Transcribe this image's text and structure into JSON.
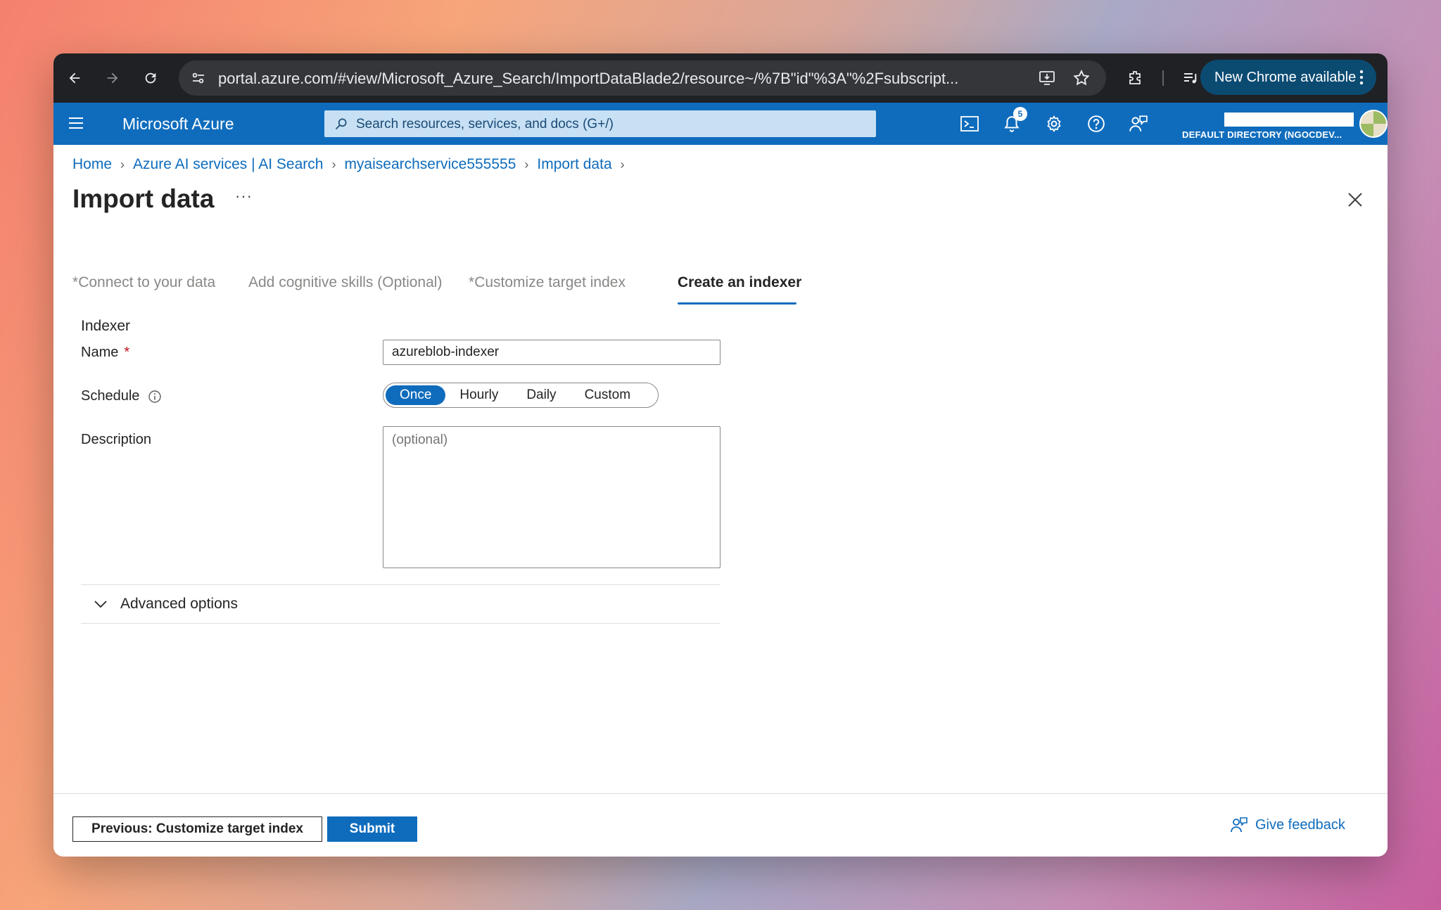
{
  "browser": {
    "url": "portal.azure.com/#view/Microsoft_Azure_Search/ImportDataBlade2/resource~/%7B\"id\"%3A\"%2Fsubscript...",
    "update_label": "New Chrome available"
  },
  "azure": {
    "brand": "Microsoft Azure",
    "search_placeholder": "Search resources, services, and docs (G+/)",
    "notification_count": "5",
    "directory": "DEFAULT DIRECTORY (NGOCDEV..."
  },
  "breadcrumb": [
    {
      "label": "Home"
    },
    {
      "label": "Azure AI services | AI Search"
    },
    {
      "label": "myaisearchservice555555"
    },
    {
      "label": "Import data"
    }
  ],
  "page": {
    "title": "Import data",
    "more": "···"
  },
  "tabs": [
    {
      "label": "Connect to your data",
      "required": "*"
    },
    {
      "label": "Add cognitive skills (Optional)",
      "required": ""
    },
    {
      "label": "Customize target index",
      "required": "*"
    },
    {
      "label": "Create an indexer",
      "required": ""
    }
  ],
  "form": {
    "section": "Indexer",
    "name_label": "Name",
    "name_required": "*",
    "name_value": "azureblob-indexer",
    "schedule_label": "Schedule",
    "schedule_options": [
      "Once",
      "Hourly",
      "Daily",
      "Custom"
    ],
    "schedule_selected": "Once",
    "description_label": "Description",
    "description_placeholder": "(optional)",
    "advanced_label": "Advanced options"
  },
  "footer": {
    "previous_label": "Previous: Customize target index",
    "submit_label": "Submit",
    "feedback_label": "Give feedback"
  },
  "colors": {
    "azure_blue": "#0f6cbd",
    "chrome_dark": "#202124"
  }
}
